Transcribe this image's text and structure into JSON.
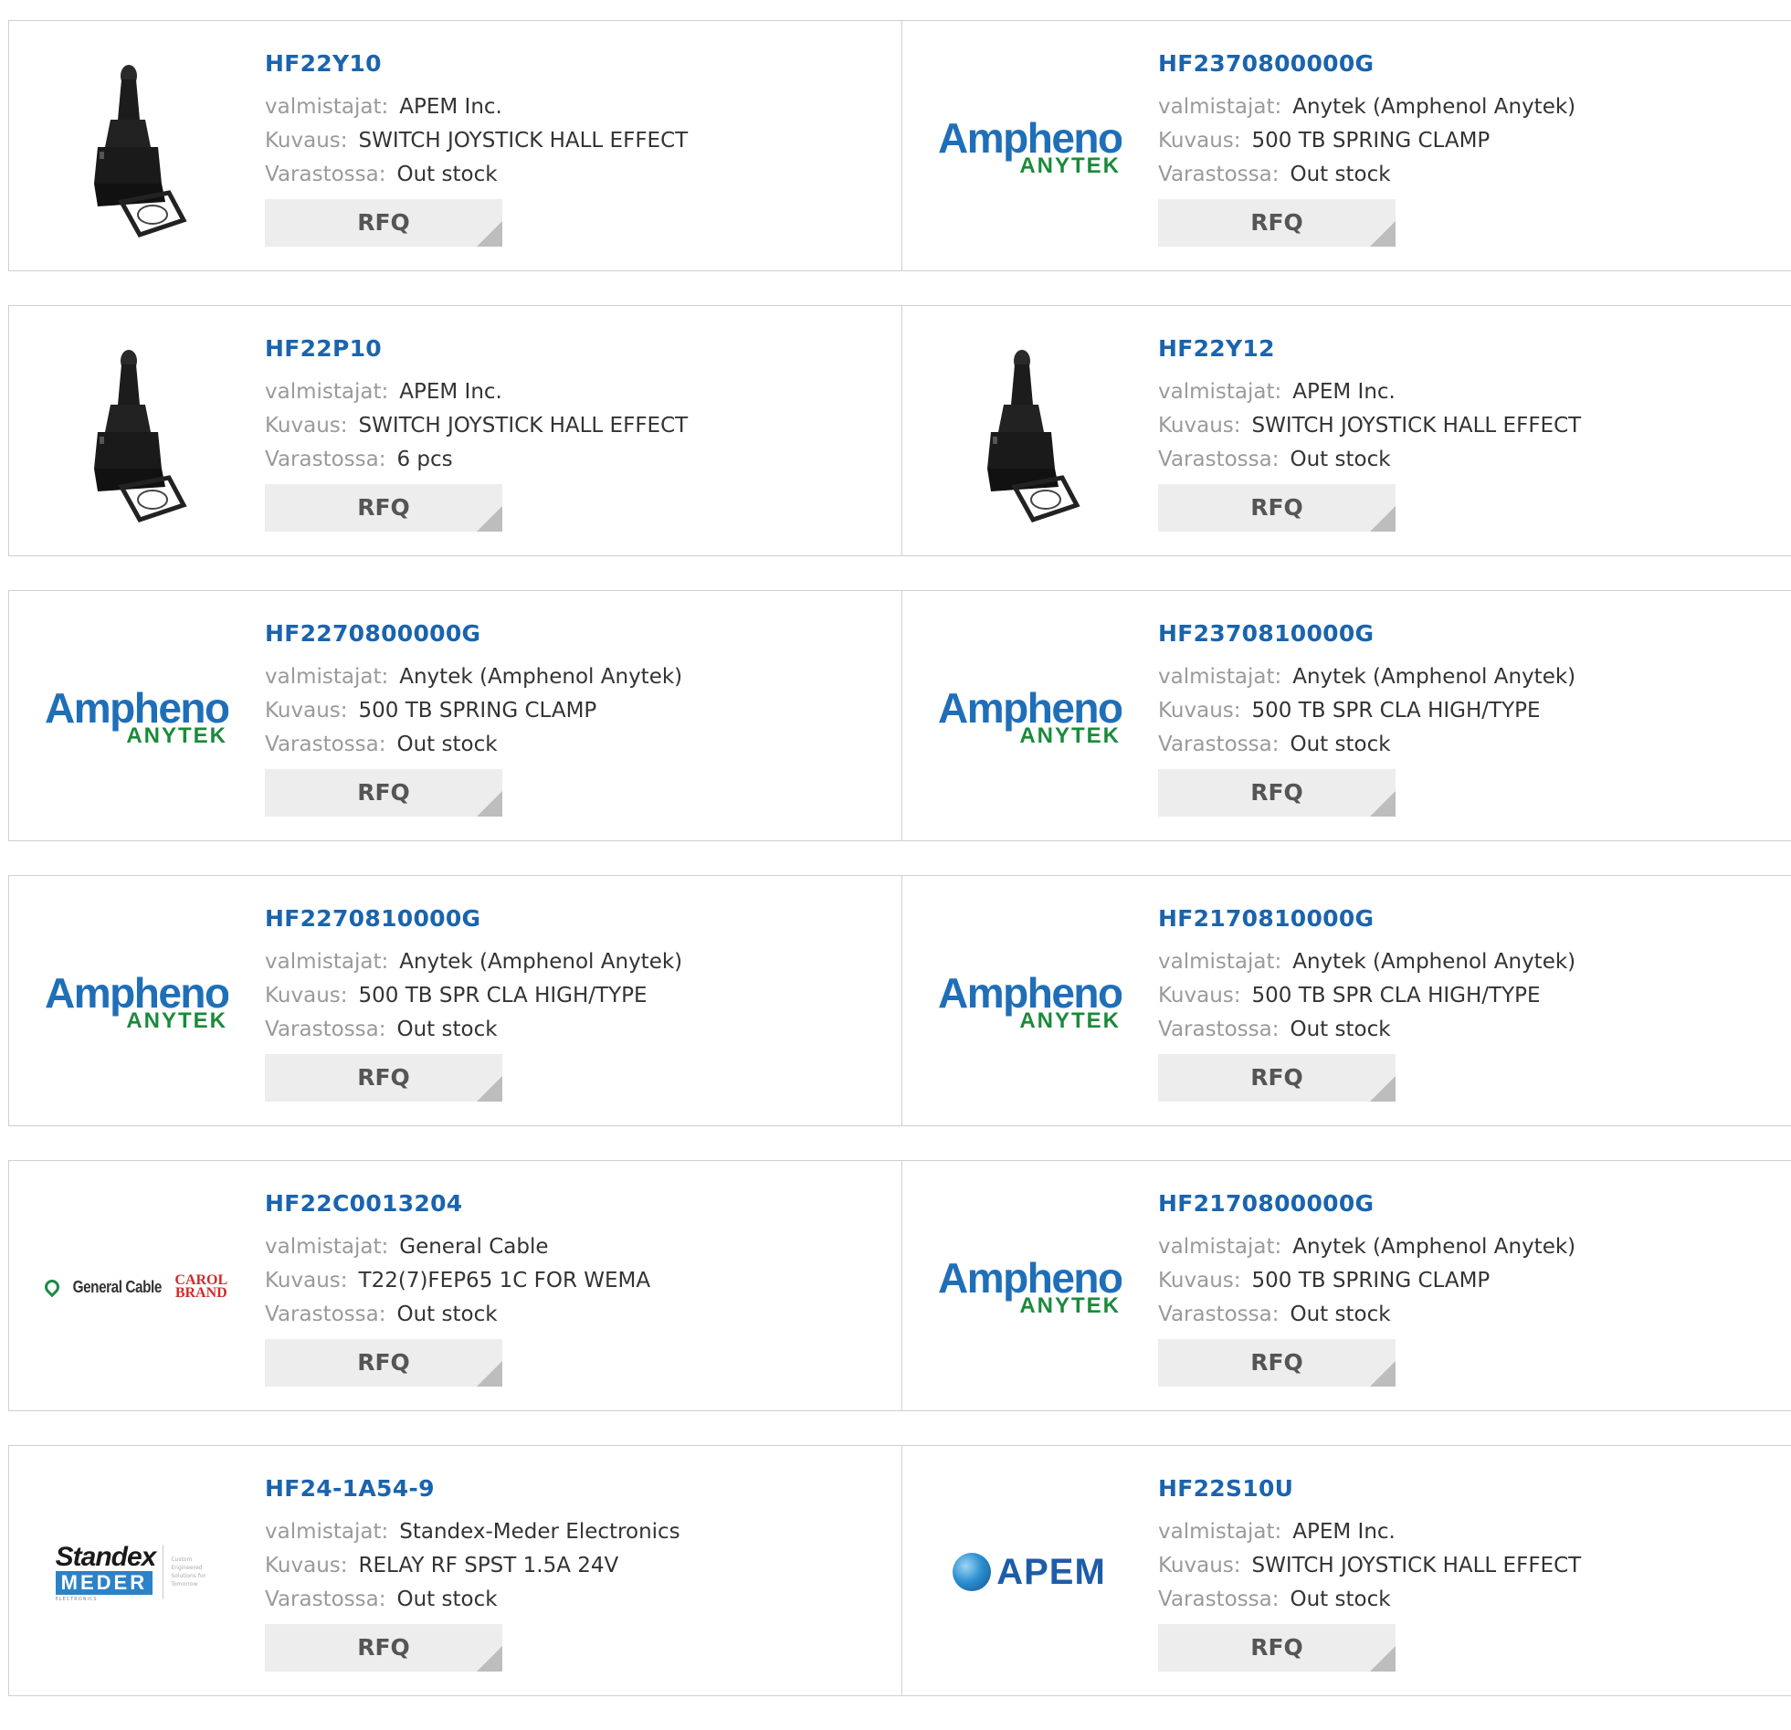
{
  "labels": {
    "manufacturer": "valmistajat:",
    "description": "Kuvaus:",
    "stock": "Varastossa:",
    "rfq": "RFQ"
  },
  "logos": {
    "amphenol_top": "Amphenol",
    "amphenol_bottom": "ANYTEK",
    "general_cable": "General Cable",
    "carol_brand_1": "CAROL",
    "carol_brand_2": "BRAND",
    "standex": "Standex",
    "meder": "MEDER",
    "meder_sub": "ELECTRONICS",
    "standex_tagline": "Custom Engineered Solutions for Tomorrow",
    "apem": "APEM"
  },
  "colors": {
    "part_link": "#1a64ae",
    "label": "#9a9a9a",
    "value": "#333333",
    "rfq_bg": "#ededed",
    "border": "#cfcfcf"
  },
  "products": [
    {
      "part": "HF22Y10",
      "manufacturer": "APEM Inc.",
      "description": "SWITCH JOYSTICK HALL EFFECT",
      "stock": "Out stock",
      "image": "joystick-photo"
    },
    {
      "part": "HF2370800000G",
      "manufacturer": "Anytek (Amphenol Anytek)",
      "description": "500 TB SPRING CLAMP",
      "stock": "Out stock",
      "image": "amphenol-anytek-logo"
    },
    {
      "part": "HF22P10",
      "manufacturer": "APEM Inc.",
      "description": "SWITCH JOYSTICK HALL EFFECT",
      "stock": "6 pcs",
      "image": "joystick-photo"
    },
    {
      "part": "HF22Y12",
      "manufacturer": "APEM Inc.",
      "description": "SWITCH JOYSTICK HALL EFFECT",
      "stock": "Out stock",
      "image": "joystick-photo"
    },
    {
      "part": "HF2270800000G",
      "manufacturer": "Anytek (Amphenol Anytek)",
      "description": "500 TB SPRING CLAMP",
      "stock": "Out stock",
      "image": "amphenol-anytek-logo"
    },
    {
      "part": "HF2370810000G",
      "manufacturer": "Anytek (Amphenol Anytek)",
      "description": "500 TB SPR CLA HIGH/TYPE",
      "stock": "Out stock",
      "image": "amphenol-anytek-logo"
    },
    {
      "part": "HF2270810000G",
      "manufacturer": "Anytek (Amphenol Anytek)",
      "description": "500 TB SPR CLA HIGH/TYPE",
      "stock": "Out stock",
      "image": "amphenol-anytek-logo"
    },
    {
      "part": "HF2170810000G",
      "manufacturer": "Anytek (Amphenol Anytek)",
      "description": "500 TB SPR CLA HIGH/TYPE",
      "stock": "Out stock",
      "image": "amphenol-anytek-logo"
    },
    {
      "part": "HF22C0013204",
      "manufacturer": "General Cable",
      "description": "T22(7)FEP65 1C FOR WEMA",
      "stock": "Out stock",
      "image": "general-cable-logo"
    },
    {
      "part": "HF2170800000G",
      "manufacturer": "Anytek (Amphenol Anytek)",
      "description": "500 TB SPRING CLAMP",
      "stock": "Out stock",
      "image": "amphenol-anytek-logo"
    },
    {
      "part": "HF24-1A54-9",
      "manufacturer": "Standex-Meder Electronics",
      "description": "RELAY RF SPST 1.5A 24V",
      "stock": "Out stock",
      "image": "standex-meder-logo"
    },
    {
      "part": "HF22S10U",
      "manufacturer": "APEM Inc.",
      "description": "SWITCH JOYSTICK HALL EFFECT",
      "stock": "Out stock",
      "image": "apem-logo"
    }
  ]
}
